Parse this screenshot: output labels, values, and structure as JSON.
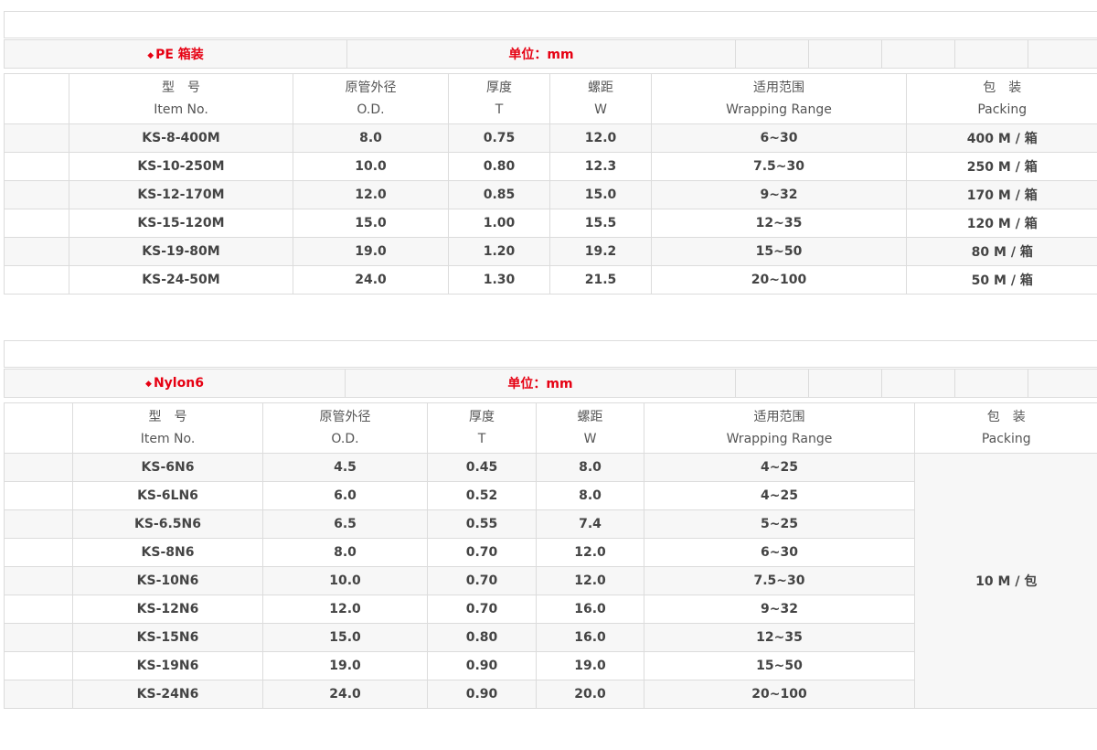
{
  "colors": {
    "accent": "#e60012",
    "border": "#dcdcdc",
    "stripe": "#f7f7f7"
  },
  "sections": [
    {
      "title": "PE 箱装",
      "unit": "单位：mm",
      "headers": [
        {
          "zh": "",
          "en": ""
        },
        {
          "zh": "型　号",
          "en": "Item No."
        },
        {
          "zh": "原管外径",
          "en": "O.D."
        },
        {
          "zh": "厚度",
          "en": "T"
        },
        {
          "zh": "螺距",
          "en": "W"
        },
        {
          "zh": "适用范围",
          "en": "Wrapping Range"
        },
        {
          "zh": "包　装",
          "en": "Packing"
        }
      ],
      "rows": [
        [
          "KS-8-400M",
          "8.0",
          "0.75",
          "12.0",
          "6~30",
          "400 M / 箱"
        ],
        [
          "KS-10-250M",
          "10.0",
          "0.80",
          "12.3",
          "7.5~30",
          "250 M / 箱"
        ],
        [
          "KS-12-170M",
          "12.0",
          "0.85",
          "15.0",
          "9~32",
          "170 M / 箱"
        ],
        [
          "KS-15-120M",
          "15.0",
          "1.00",
          "15.5",
          "12~35",
          "120 M / 箱"
        ],
        [
          "KS-19-80M",
          "19.0",
          "1.20",
          "19.2",
          "15~50",
          "80 M / 箱"
        ],
        [
          "KS-24-50M",
          "24.0",
          "1.30",
          "21.5",
          "20~100",
          "50 M / 箱"
        ]
      ]
    },
    {
      "title": "Nylon6",
      "unit": "单位：mm",
      "headers": [
        {
          "zh": "",
          "en": ""
        },
        {
          "zh": "型　号",
          "en": "Item No."
        },
        {
          "zh": "原管外径",
          "en": "O.D."
        },
        {
          "zh": "厚度",
          "en": "T"
        },
        {
          "zh": "螺距",
          "en": "W"
        },
        {
          "zh": "适用范围",
          "en": "Wrapping Range"
        },
        {
          "zh": "包　装",
          "en": "Packing"
        }
      ],
      "packing": "10 M / 包",
      "rows": [
        [
          "KS-6N6",
          "4.5",
          "0.45",
          "8.0",
          "4~25"
        ],
        [
          "KS-6LN6",
          "6.0",
          "0.52",
          "8.0",
          "4~25"
        ],
        [
          "KS-6.5N6",
          "6.5",
          "0.55",
          "7.4",
          "5~25"
        ],
        [
          "KS-8N6",
          "8.0",
          "0.70",
          "12.0",
          "6~30"
        ],
        [
          "KS-10N6",
          "10.0",
          "0.70",
          "12.0",
          "7.5~30"
        ],
        [
          "KS-12N6",
          "12.0",
          "0.70",
          "16.0",
          "9~32"
        ],
        [
          "KS-15N6",
          "15.0",
          "0.80",
          "16.0",
          "12~35"
        ],
        [
          "KS-19N6",
          "19.0",
          "0.90",
          "19.0",
          "15~50"
        ],
        [
          "KS-24N6",
          "24.0",
          "0.90",
          "20.0",
          "20~100"
        ]
      ]
    }
  ]
}
